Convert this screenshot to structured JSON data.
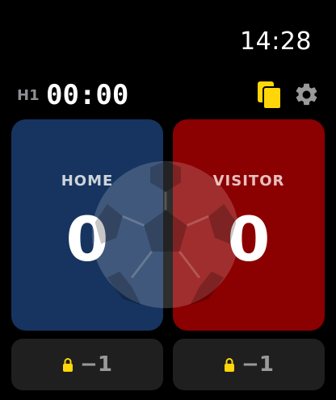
{
  "status_bar": {
    "time": "14:28"
  },
  "header": {
    "half": "H1",
    "timer": "00:00",
    "cards_icon": "yellow-cards-icon",
    "settings_icon": "gear-icon"
  },
  "teams": [
    {
      "name": "HOME",
      "score": "0",
      "color": "#16345f"
    },
    {
      "name": "VISITOR",
      "score": "0",
      "color": "#8b0000"
    }
  ],
  "adjust": [
    {
      "label": "−1",
      "icon": "lock-icon"
    },
    {
      "label": "−1",
      "icon": "lock-icon"
    }
  ],
  "colors": {
    "accent": "#ffd60a",
    "home": "#16345f",
    "visitor": "#8b0000"
  },
  "watermark_icon": "soccer-ball-icon"
}
